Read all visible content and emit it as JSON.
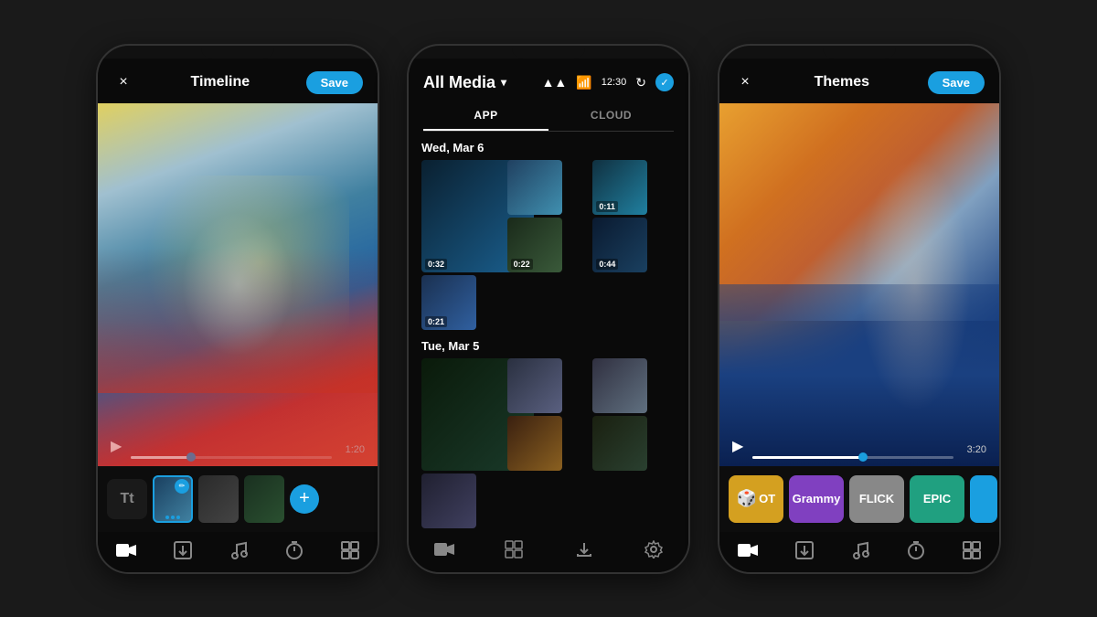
{
  "background": "#1a1a1a",
  "phone1": {
    "title": "Timeline",
    "close_btn": "×",
    "save_btn": "Save",
    "video_time": "1:20",
    "progress_percent": 30,
    "toolbar_items": [
      "▶",
      "↑",
      "♪",
      "⏱",
      "▣"
    ]
  },
  "phone2": {
    "title": "All Media",
    "status_time": "12:30",
    "tabs": [
      {
        "label": "APP",
        "active": true
      },
      {
        "label": "CLOUD",
        "active": false
      }
    ],
    "sections": [
      {
        "date": "Wed, Mar 6",
        "clips": [
          {
            "duration": "0:32",
            "color": "blue1"
          },
          {
            "duration": "",
            "color": "blue2"
          },
          {
            "duration": "0:11",
            "color": "teal"
          },
          {
            "duration": "0:22",
            "color": "dark1"
          },
          {
            "duration": "0:44",
            "color": "river"
          },
          {
            "duration": "0:21",
            "color": "group"
          }
        ]
      },
      {
        "date": "Tue, Mar 5",
        "clips": [
          {
            "duration": "",
            "color": "forest1"
          },
          {
            "duration": "",
            "color": "bike1"
          },
          {
            "duration": "",
            "color": "bike2"
          },
          {
            "duration": "",
            "color": "orange"
          },
          {
            "duration": "",
            "color": "forest2"
          },
          {
            "duration": "",
            "color": "mtb"
          }
        ]
      }
    ],
    "toolbar_items": [
      "▣",
      "▤",
      "⬇",
      "⚙"
    ]
  },
  "phone3": {
    "title": "Themes",
    "close_btn": "×",
    "save_btn": "Save",
    "video_time": "3:20",
    "progress_percent": 55,
    "themes": [
      {
        "label": "LOOT",
        "icon": "🎲",
        "class": "theme-loot"
      },
      {
        "label": "Grammy",
        "class": "theme-grammy"
      },
      {
        "label": "FLICK",
        "class": "theme-flick"
      },
      {
        "label": "EPIC",
        "class": "theme-epic"
      },
      {
        "label": "",
        "class": "theme-blue"
      }
    ],
    "toolbar_items": [
      "▣",
      "↑",
      "♪",
      "⏱",
      "▣"
    ]
  }
}
